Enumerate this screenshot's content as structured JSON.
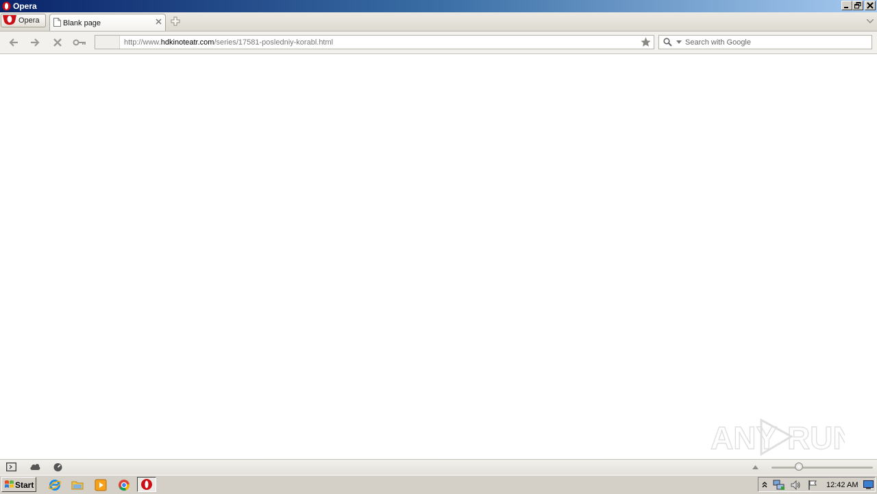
{
  "window": {
    "title": "Opera"
  },
  "tabbar": {
    "menu_label": "Opera",
    "tabs": [
      {
        "label": "Blank page",
        "active": true
      }
    ]
  },
  "navbar": {
    "url_prefix": "http://www.",
    "url_domain": "hdkinoteatr.com",
    "url_path": "/series/17581-posledniy-korabl.html",
    "search_placeholder": "Search with Google"
  },
  "taskbar": {
    "start_label": "Start",
    "clock": "12:42 AM",
    "pinned": [
      "internet-explorer-icon",
      "folder-icon",
      "media-player-icon",
      "chrome-icon",
      "opera-icon"
    ]
  },
  "watermark": {
    "text_left": "ANY",
    "text_right": "RUN"
  },
  "colors": {
    "titlebar_start": "#0a246a",
    "titlebar_end": "#a6caf0",
    "opera_red": "#cc0f16"
  }
}
